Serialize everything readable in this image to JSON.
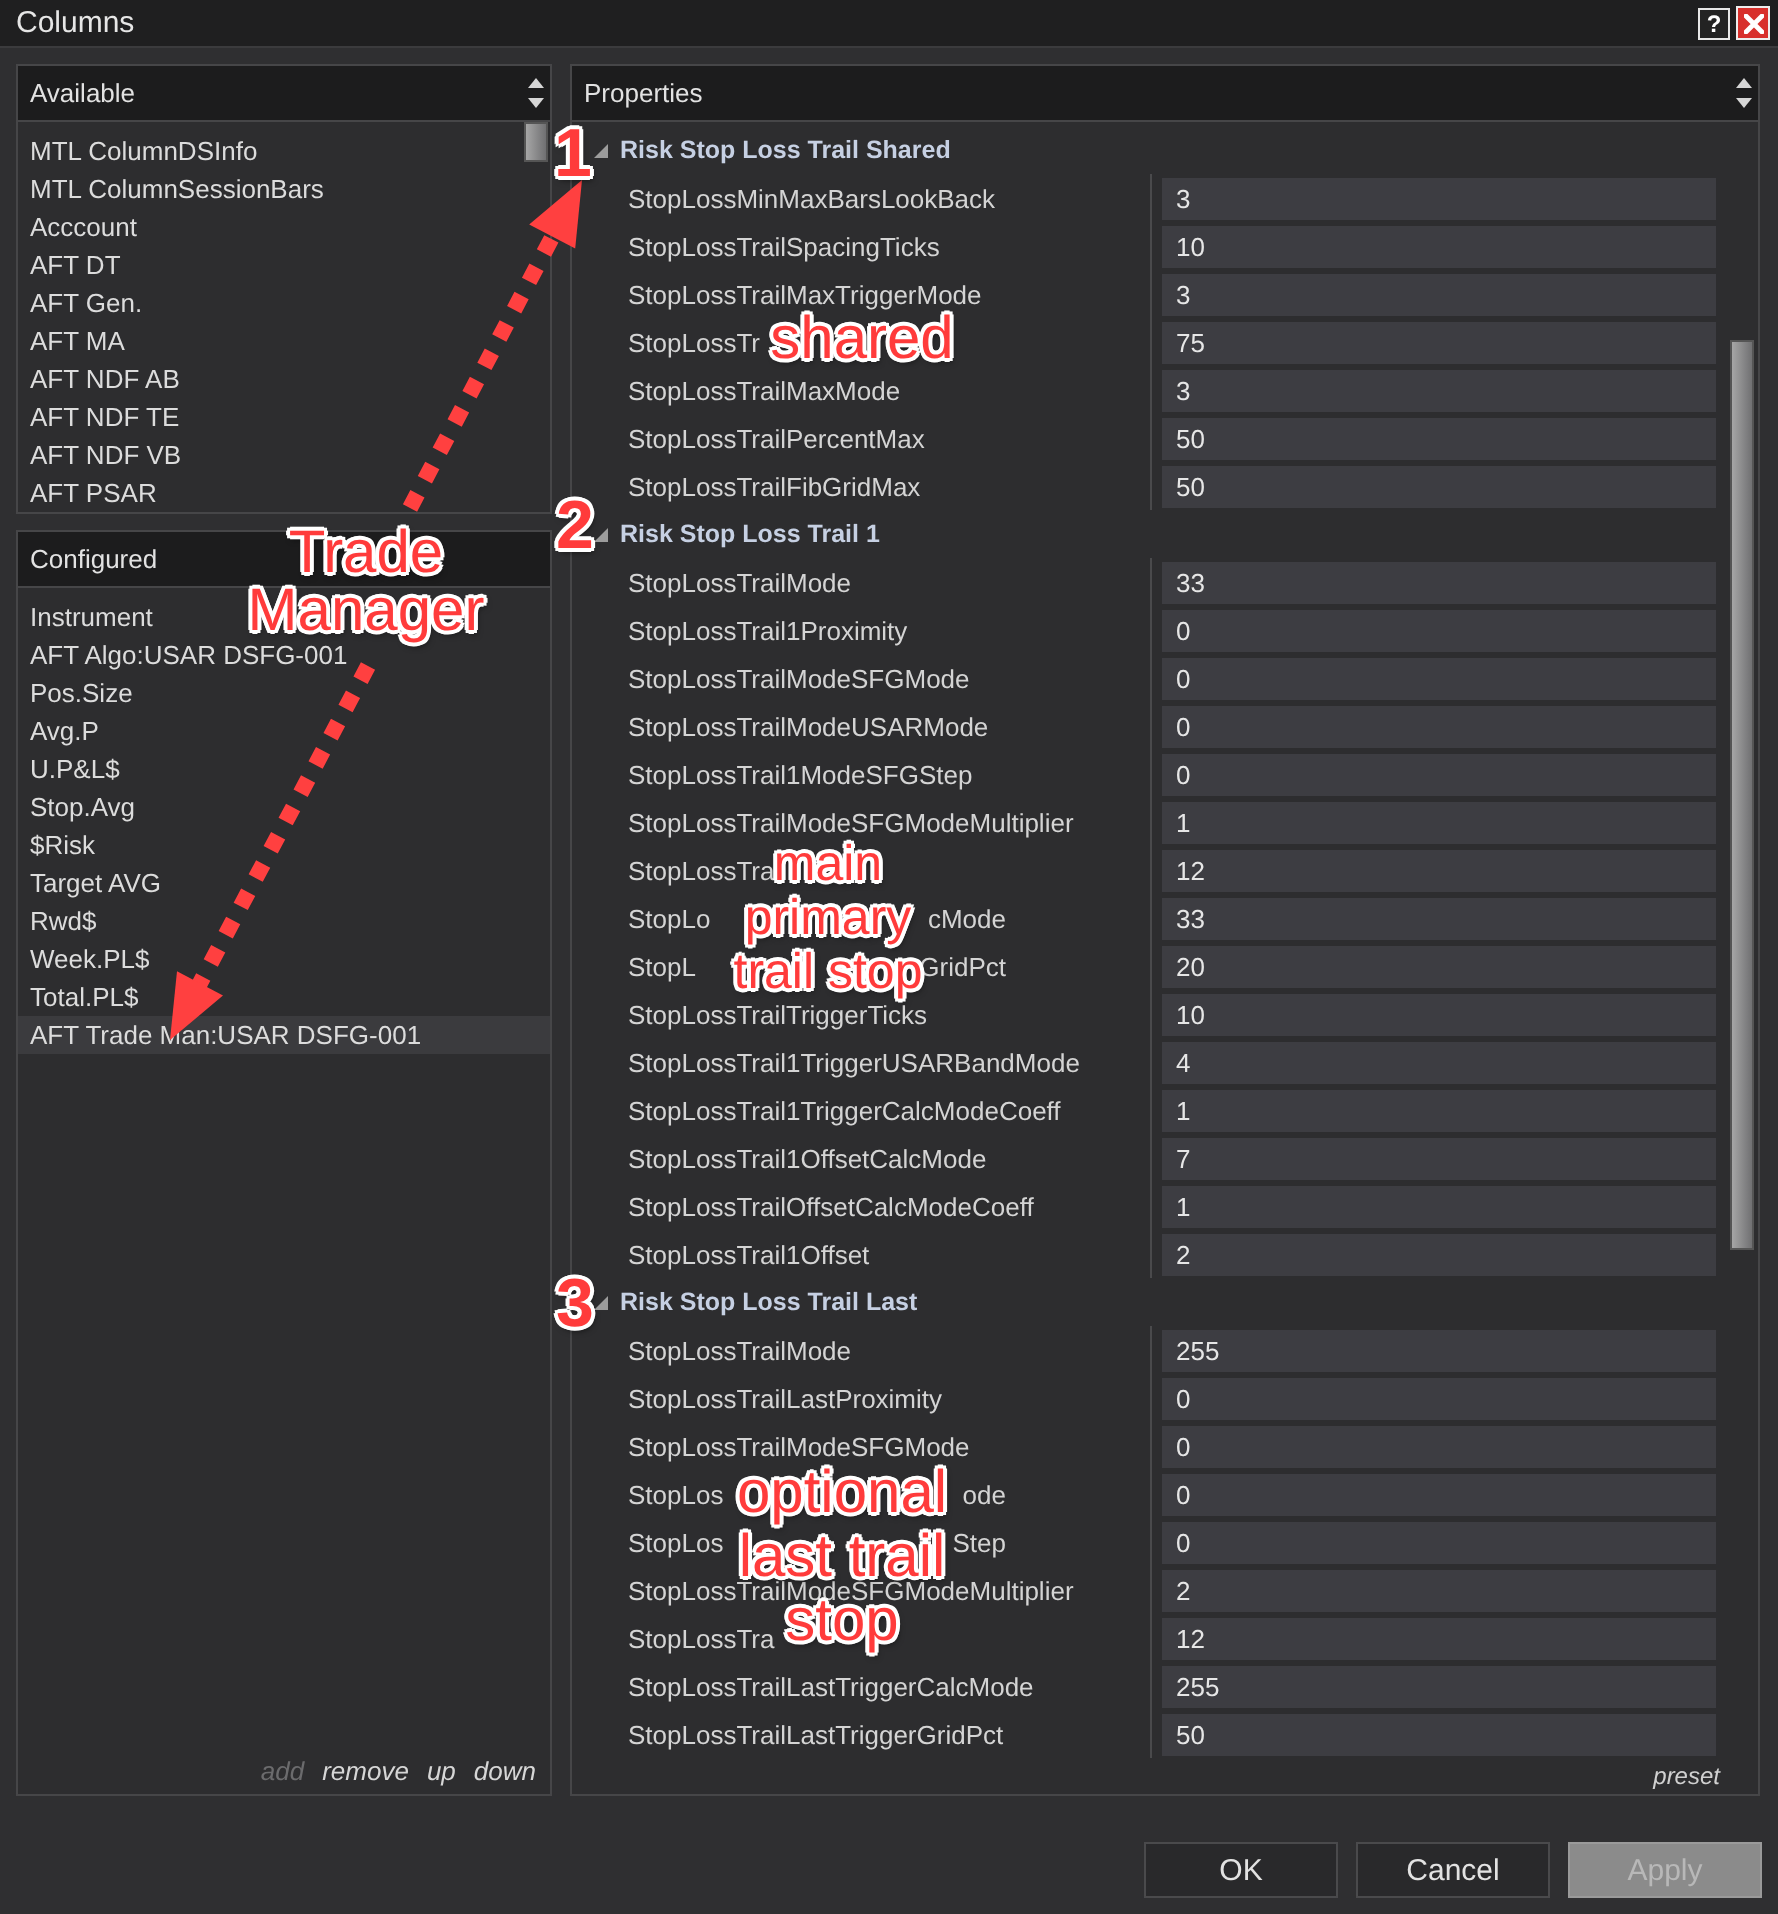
{
  "window": {
    "title": "Columns",
    "help": "?"
  },
  "available": {
    "title": "Available",
    "items": [
      {
        "label": "MTL ColumnDSInfo",
        "selected": false
      },
      {
        "label": "MTL ColumnSessionBars",
        "selected": false
      },
      {
        "label": "Acccount",
        "selected": false
      },
      {
        "label": "AFT DT",
        "selected": false
      },
      {
        "label": "AFT Gen.",
        "selected": false
      },
      {
        "label": "AFT MA",
        "selected": false
      },
      {
        "label": "AFT NDF AB",
        "selected": false
      },
      {
        "label": "AFT NDF TE",
        "selected": false
      },
      {
        "label": "AFT NDF VB",
        "selected": false
      },
      {
        "label": "AFT PSAR",
        "selected": false
      }
    ]
  },
  "configured": {
    "title": "Configured",
    "items": [
      {
        "label": "Instrument",
        "selected": false
      },
      {
        "label": "AFT Algo:USAR DSFG-001",
        "selected": false
      },
      {
        "label": "Pos.Size",
        "selected": false
      },
      {
        "label": "Avg.P",
        "selected": false
      },
      {
        "label": "U.P&L$",
        "selected": false
      },
      {
        "label": "Stop.Avg",
        "selected": false
      },
      {
        "label": "$Risk",
        "selected": false
      },
      {
        "label": "Target AVG",
        "selected": false
      },
      {
        "label": "Rwd$",
        "selected": false
      },
      {
        "label": "Week.PL$",
        "selected": false
      },
      {
        "label": "Total.PL$",
        "selected": false
      },
      {
        "label": "AFT Trade Man:USAR DSFG-001",
        "selected": true
      }
    ],
    "actions": [
      {
        "label": "add",
        "disabled": true
      },
      {
        "label": "remove",
        "disabled": false
      },
      {
        "label": "up",
        "disabled": false
      },
      {
        "label": "down",
        "disabled": false
      }
    ]
  },
  "properties": {
    "title": "Properties",
    "groups": [
      {
        "title": "Risk Stop Loss Trail Shared",
        "expanded": true,
        "rows": [
          {
            "name": "StopLossMinMaxBarsLookBack",
            "value": "3"
          },
          {
            "name": "StopLossTrailSpacingTicks",
            "value": "10"
          },
          {
            "name": "StopLossTrailMaxTriggerMode",
            "value": "3"
          },
          {
            "name": "StopLossTr",
            "value": "75"
          },
          {
            "name": "StopLossTrailMaxMode",
            "value": "3"
          },
          {
            "name": "StopLossTrailPercentMax",
            "value": "50"
          },
          {
            "name": "StopLossTrailFibGridMax",
            "value": "50"
          }
        ]
      },
      {
        "title": "Risk Stop Loss Trail 1",
        "expanded": true,
        "rows": [
          {
            "name": "StopLossTrailMode",
            "value": "33"
          },
          {
            "name": "StopLossTrail1Proximity",
            "value": "0"
          },
          {
            "name": "StopLossTrailModeSFGMode",
            "value": "0"
          },
          {
            "name": "StopLossTrailModeUSARMode",
            "value": "0"
          },
          {
            "name": "StopLossTrail1ModeSFGStep",
            "value": "0"
          },
          {
            "name": "StopLossTrailModeSFGModeMultiplier",
            "value": "1"
          },
          {
            "name": "StopLossTra",
            "value": "12"
          },
          {
            "name": "StopLo",
            "name_end": "cMode",
            "value": "33"
          },
          {
            "name": "StopL",
            "name_end": "GridPct",
            "value": "20"
          },
          {
            "name": "StopLossTrailTriggerTicks",
            "value": "10"
          },
          {
            "name": "StopLossTrail1TriggerUSARBandMode",
            "value": "4"
          },
          {
            "name": "StopLossTrail1TriggerCalcModeCoeff",
            "value": "1"
          },
          {
            "name": "StopLossTrail1OffsetCalcMode",
            "value": "7"
          },
          {
            "name": "StopLossTrailOffsetCalcModeCoeff",
            "value": "1"
          },
          {
            "name": "StopLossTrail1Offset",
            "value": "2"
          }
        ]
      },
      {
        "title": "Risk Stop Loss Trail Last",
        "expanded": true,
        "rows": [
          {
            "name": "StopLossTrailMode",
            "value": "255"
          },
          {
            "name": "StopLossTrailLastProximity",
            "value": "0"
          },
          {
            "name": "StopLossTrailModeSFGMode",
            "value": "0"
          },
          {
            "name": "StopLos",
            "name_end": "ode",
            "value": "0"
          },
          {
            "name": "StopLos",
            "name_end": "Step",
            "value": "0"
          },
          {
            "name": "StopLossTrailModeSFGModeMultiplier",
            "value": "2"
          },
          {
            "name": "StopLossTra",
            "value": "12"
          },
          {
            "name": "StopLossTrailLastTriggerCalcMode",
            "value": "255"
          },
          {
            "name": "StopLossTrailLastTriggerGridPct",
            "value": "50"
          }
        ]
      }
    ],
    "footer_link": "preset"
  },
  "buttons": [
    {
      "label": "OK",
      "disabled": false
    },
    {
      "label": "Cancel",
      "disabled": false
    },
    {
      "label": "Apply",
      "disabled": true
    }
  ],
  "annotations": [
    {
      "kind": "number",
      "text": "1"
    },
    {
      "kind": "arrow"
    },
    {
      "kind": "label",
      "lines": [
        "shared"
      ]
    },
    {
      "kind": "label",
      "lines": [
        "Trade",
        "Manager"
      ]
    },
    {
      "kind": "number",
      "text": "2"
    },
    {
      "kind": "arrow"
    },
    {
      "kind": "label",
      "lines": [
        "main",
        "primary",
        "trail stop"
      ]
    },
    {
      "kind": "number",
      "text": "3"
    },
    {
      "kind": "label",
      "lines": [
        "optional",
        "last trail",
        "stop"
      ]
    }
  ]
}
